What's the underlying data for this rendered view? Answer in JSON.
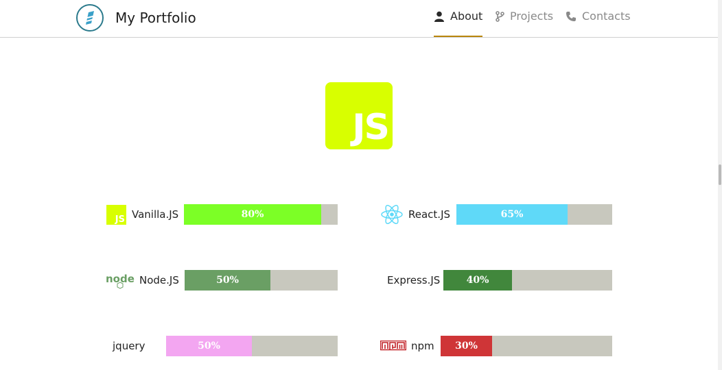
{
  "header": {
    "brand": "My Portfolio",
    "nav": [
      {
        "label": "About",
        "icon": "user-icon",
        "active": true
      },
      {
        "label": "Projects",
        "icon": "git-branch-icon",
        "active": false
      },
      {
        "label": "Contacts",
        "icon": "phone-icon",
        "active": false
      }
    ]
  },
  "hero": {
    "logo_text": "JS",
    "logo_color": "#d8ff00"
  },
  "skills": [
    {
      "name": "Vanilla.JS",
      "value": "80%",
      "percent": 80,
      "color": "#7cff26",
      "icon": "javascript-icon",
      "icon_text": "JS"
    },
    {
      "name": "React.JS",
      "value": "65%",
      "percent": 65,
      "color": "#5fd9f8",
      "icon": "react-icon"
    },
    {
      "name": "Node.JS",
      "value": "50%",
      "percent": 50,
      "color": "#6a9f64",
      "icon": "nodejs-icon"
    },
    {
      "name": "Express.JS",
      "value": "40%",
      "percent": 40,
      "color": "#41873c"
    },
    {
      "name": "jquery",
      "value": "50%",
      "percent": 50,
      "color": "#f3a6f1"
    },
    {
      "name": "npm",
      "value": "30%",
      "percent": 30,
      "color": "#cf3537",
      "icon": "npm-icon"
    }
  ],
  "colors": {
    "track": "#c8c8be",
    "nav_active_underline": "#b9860b"
  }
}
